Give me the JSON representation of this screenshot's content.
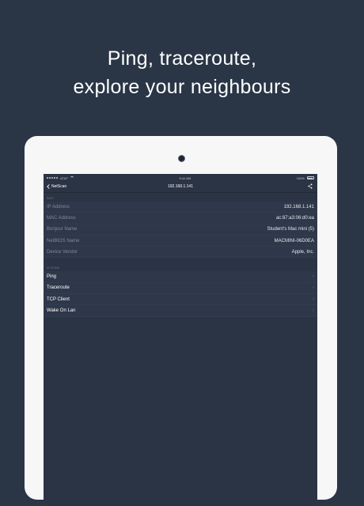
{
  "headline": {
    "line1": "Ping, traceroute,",
    "line2": "explore your neighbours"
  },
  "status_bar": {
    "carrier": "AT&T",
    "time": "9:41 AM",
    "battery": "100%"
  },
  "nav": {
    "back_label": "NetScan",
    "title": "192.168.1.141"
  },
  "info": {
    "header": "INFO",
    "rows": [
      {
        "label": "IP Address",
        "value": "192.168.1.141"
      },
      {
        "label": "MAC Address",
        "value": "ac:87:a3:06:d0:ea"
      },
      {
        "label": "Bonjour Name",
        "value": "Student's Mac mini (5)"
      },
      {
        "label": "NetBIOS Name",
        "value": "MACMINI-06D0EA"
      },
      {
        "label": "Device Vendor",
        "value": "Apple, Inc."
      }
    ]
  },
  "actions": {
    "header": "ACTIONS",
    "items": [
      {
        "label": "Ping"
      },
      {
        "label": "Traceroute"
      },
      {
        "label": "TCP Client"
      },
      {
        "label": "Wake On Lan"
      }
    ]
  },
  "colors": {
    "background": "#2a3546",
    "tablet_frame": "#f7f7f8",
    "screen": "#2b3444"
  },
  "icons": {
    "back": "chevron-left-icon",
    "share": "share-icon",
    "row_disclosure": "chevron-right-icon"
  }
}
